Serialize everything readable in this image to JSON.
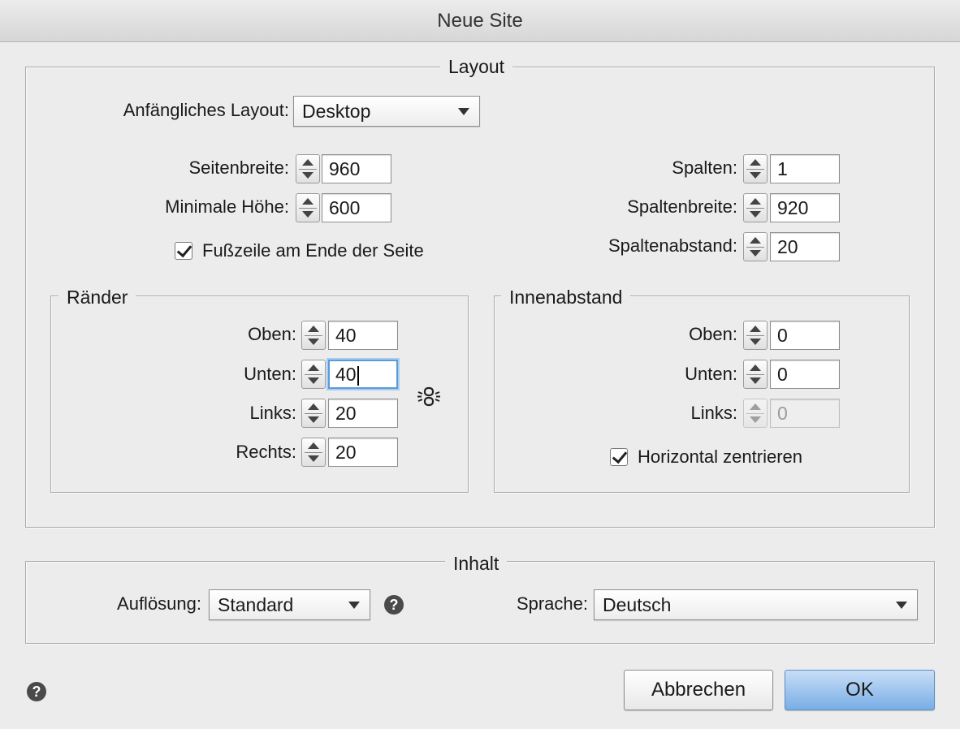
{
  "window": {
    "title": "Neue Site"
  },
  "layout": {
    "legend": "Layout",
    "initial_layout": {
      "label": "Anfängliches Layout:",
      "value": "Desktop"
    },
    "page_width": {
      "label": "Seitenbreite:",
      "value": "960"
    },
    "min_height": {
      "label": "Minimale Höhe:",
      "value": "600"
    },
    "footer_checkbox": {
      "label": "Fußzeile am Ende der Seite",
      "checked": true
    },
    "columns": {
      "label": "Spalten:",
      "value": "1"
    },
    "column_width": {
      "label": "Spaltenbreite:",
      "value": "920"
    },
    "gutter": {
      "label": "Spaltenabstand:",
      "value": "20"
    },
    "margins": {
      "legend": "Ränder",
      "top": {
        "label": "Oben:",
        "value": "40"
      },
      "bottom": {
        "label": "Unten:",
        "value": "40"
      },
      "left": {
        "label": "Links:",
        "value": "20"
      },
      "right": {
        "label": "Rechts:",
        "value": "20"
      },
      "link_icon": "chain-link-icon"
    },
    "padding": {
      "legend": "Innenabstand",
      "top": {
        "label": "Oben:",
        "value": "0"
      },
      "bottom": {
        "label": "Unten:",
        "value": "0"
      },
      "left": {
        "label": "Links:",
        "value": "0"
      },
      "center_checkbox": {
        "label": "Horizontal zentrieren",
        "checked": true
      }
    }
  },
  "content": {
    "legend": "Inhalt",
    "resolution": {
      "label": "Auflösung:",
      "value": "Standard"
    },
    "help_icon": "?",
    "language": {
      "label": "Sprache:",
      "value": "Deutsch"
    }
  },
  "footer": {
    "help_icon": "?",
    "cancel_label": "Abbrechen",
    "ok_label": "OK"
  },
  "colors": {
    "accent": "#79aee6",
    "focus": "#5b9bd8",
    "background": "#ececec"
  }
}
